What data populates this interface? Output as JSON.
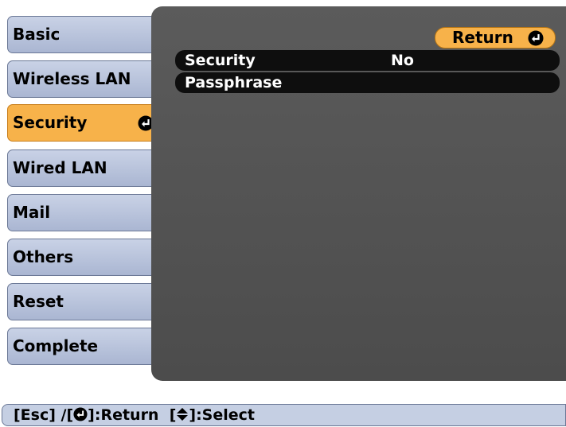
{
  "menu": {
    "items": [
      {
        "label": "Basic"
      },
      {
        "label": "Wireless LAN"
      },
      {
        "label": "Security",
        "active": true
      },
      {
        "label": "Wired LAN"
      },
      {
        "label": "Mail"
      },
      {
        "label": "Others"
      },
      {
        "label": "Reset"
      },
      {
        "label": "Complete"
      }
    ]
  },
  "panel": {
    "return_label": "Return",
    "rows": [
      {
        "label": "Security",
        "value": "No"
      },
      {
        "label": "Passphrase",
        "value": ""
      }
    ]
  },
  "helpbar": {
    "esc": "[Esc] /[",
    "return_text": "]:Return",
    "select_open": "[",
    "select_text": "]:Select"
  },
  "colors": {
    "menu_bg": "#b9c4de",
    "active_bg": "#f7b24a",
    "panel_bg": "#555555",
    "row_bg": "#0e0e0e"
  },
  "icons": {
    "enter": "enter-icon",
    "updown": "up-down-arrow-icon"
  }
}
